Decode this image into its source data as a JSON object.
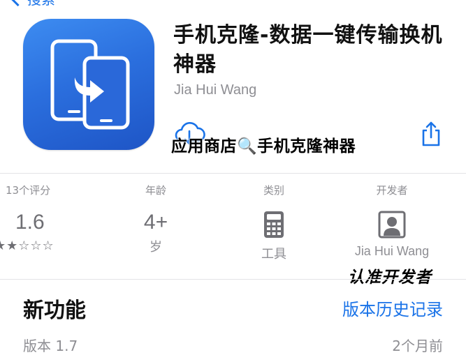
{
  "nav": {
    "back_label": "搜索"
  },
  "app": {
    "title": "手机克隆-数据一键传输换机神器",
    "developer": "Jia Hui Wang",
    "overlay_text": "应用商店🔍手机克隆神器"
  },
  "stats": {
    "rating": {
      "label": "13个评分",
      "value": "1.6",
      "stars": "★★☆☆☆",
      "stars_filled": 1.6
    },
    "age": {
      "label": "年龄",
      "value": "4+",
      "sub": "岁"
    },
    "category": {
      "label": "类别",
      "sub": "工具",
      "icon": "calculator-icon"
    },
    "developer": {
      "label": "开发者",
      "sub": "Jia Hui Wang",
      "icon": "person-icon"
    }
  },
  "stamp_text": "认准开发者",
  "whats_new": {
    "title": "新功能",
    "history_link": "版本历史记录",
    "version": "版本 1.7",
    "time_ago": "2个月前"
  },
  "colors": {
    "accent": "#1a73e8",
    "icon_gradient_top": "#3d8cf1",
    "icon_gradient_bottom": "#1e55c6",
    "muted": "#8e8e93"
  }
}
